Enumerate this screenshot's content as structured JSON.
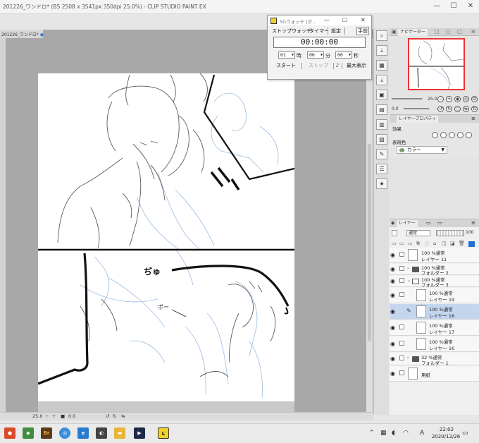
{
  "window": {
    "title": "201226_ワンドロ* (B5 2508 x 3541px 350dpi 25.0%) - CLIP STUDIO PAINT EX",
    "minimize": "—",
    "maximize": "☐",
    "close": "✕"
  },
  "document_tab": {
    "label": "201226_ワンドロ*",
    "modified_dot": "●"
  },
  "sg_watch": {
    "title": "SGウォッチ [ダ...",
    "menu": [
      "ストップウォッチ",
      "タイマー",
      "設定",
      "手前"
    ],
    "clock": "00:00:00",
    "hours": "01",
    "minutes": "00",
    "seconds": "00",
    "hours_unit": "時",
    "minutes_unit": "分",
    "seconds_unit": "秒",
    "start_label": "スタート",
    "stop_label": "ストップ",
    "note_icon": "♪",
    "maximize_label": "最大表示"
  },
  "navigator": {
    "tab_label": "ナビゲーター",
    "zoom_value": "25.0",
    "rotation_value": "0.0"
  },
  "layer_property": {
    "tab_label": "レイヤープロパティ",
    "effect_label": "効果",
    "expression_color_label": "表現色",
    "expression_color_value": "カラー"
  },
  "layer_panel": {
    "tab_label": "レイヤー",
    "blend_mode": "通常",
    "opacity": "100",
    "layers": [
      {
        "line1": "100 %通常",
        "line2": "レイヤー 11",
        "type": "layer",
        "selected": false
      },
      {
        "line1": "100 %通常",
        "line2": "フォルダー 2",
        "type": "folder",
        "selected": false
      },
      {
        "line1": "100 %通常",
        "line2": "フォルダー 3",
        "type": "folder-open",
        "selected": false
      },
      {
        "line1": "100 %通常",
        "line2": "レイヤー 19",
        "type": "nested",
        "selected": false
      },
      {
        "line1": "100 %通常",
        "line2": "レイヤー 18",
        "type": "nested",
        "selected": true
      },
      {
        "line1": "100 %通常",
        "line2": "レイヤー 17",
        "type": "nested",
        "selected": false
      },
      {
        "line1": "100 %通常",
        "line2": "レイヤー 16",
        "type": "nested",
        "selected": false
      },
      {
        "line1": "32 %通常",
        "line2": "フォルダー 1",
        "type": "folder",
        "selected": false
      },
      {
        "line1": "",
        "line2": "用紙",
        "type": "paper",
        "selected": false
      }
    ]
  },
  "statusbar": {
    "zoom": "25.0",
    "rotation": "0.0"
  },
  "canvas_text": {
    "sfx1": "ぢゅ",
    "sfx2": "ポー"
  },
  "taskbar": {
    "time": "22:02",
    "date": "2020/12/26",
    "ime": "A",
    "icons": [
      "browser-icon",
      "bridge-icon",
      "chrome-icon",
      "edge-icon",
      "app-icon",
      "explorer-icon",
      "media-icon",
      "clip-studio-icon"
    ]
  },
  "colors": {
    "accent_red": "#e33333",
    "selection_blue": "#c4d6ee",
    "sketch_blue": "#9bbbe0",
    "clip_yellow": "#f2d32a"
  }
}
